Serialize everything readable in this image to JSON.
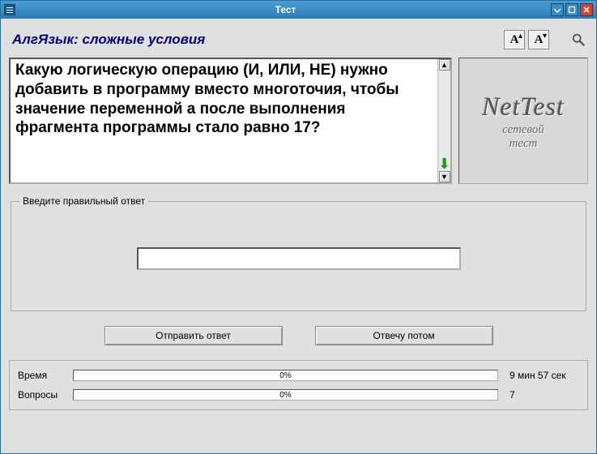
{
  "window": {
    "title": "Тест"
  },
  "header": {
    "topic": "АлгЯзык: сложные условия"
  },
  "question": {
    "text": "Какую логическую операцию (И, ИЛИ, НЕ) нужно добавить в программу вместо многоточия, чтобы значение переменной a после выполнения фрагмента программы стало равно 17?"
  },
  "logo": {
    "title": "NetTest",
    "subtitle1": "сетевой",
    "subtitle2": "тест"
  },
  "answer": {
    "legend": "Введите правильный ответ",
    "value": "",
    "placeholder": ""
  },
  "buttons": {
    "submit": "Отправить ответ",
    "later": "Отвечу потом"
  },
  "status": {
    "time_label": "Время",
    "time_percent": "0%",
    "time_value": "9 мин 57 сек",
    "questions_label": "Вопросы",
    "questions_percent": "0%",
    "questions_value": "7"
  },
  "icons": {
    "font_letter": "A",
    "font_up": "▴",
    "font_down": "▾",
    "scroll_up": "▲",
    "scroll_down": "▼",
    "green_down": "⬇"
  }
}
